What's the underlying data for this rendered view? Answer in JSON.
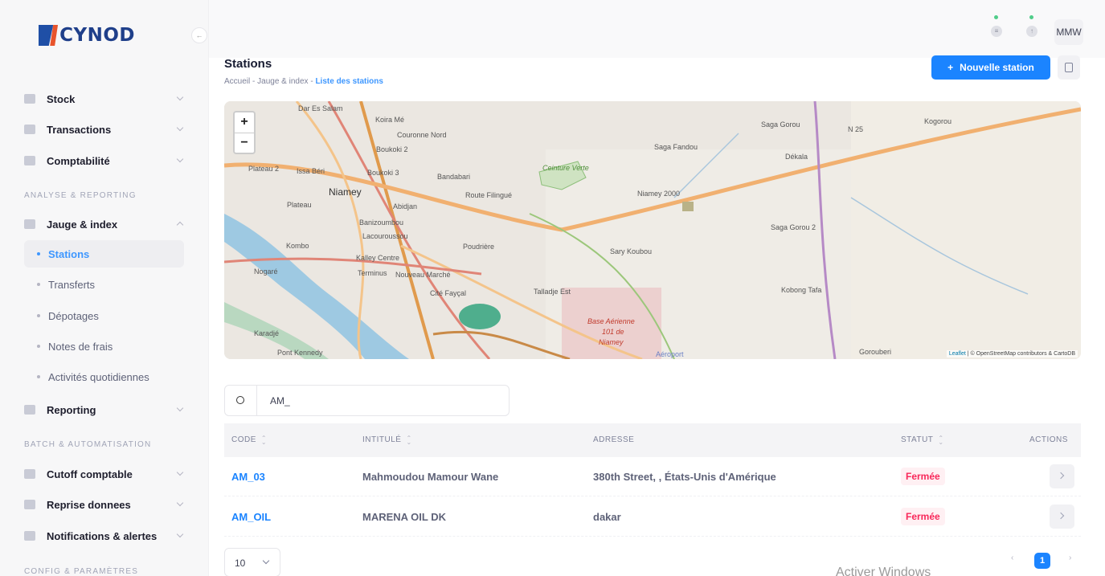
{
  "app": {
    "logo_text": "CYNOD"
  },
  "topbar": {
    "user_initials": "MMW"
  },
  "sidebar": {
    "items": [
      {
        "label": "Stock",
        "icon": "box-icon"
      },
      {
        "label": "Transactions",
        "icon": "transactions-icon"
      },
      {
        "label": "Comptabilité",
        "icon": "grid-icon"
      }
    ],
    "section_analyse": "ANALYSE & REPORTING",
    "jauge": {
      "label": "Jauge & index",
      "icon": "gauge-icon"
    },
    "sub_items": [
      {
        "label": "Stations",
        "active": true
      },
      {
        "label": "Transferts",
        "active": false
      },
      {
        "label": "Dépotages",
        "active": false
      },
      {
        "label": "Notes de frais",
        "active": false
      },
      {
        "label": "Activités quotidiennes",
        "active": false
      }
    ],
    "reporting": {
      "label": "Reporting",
      "icon": "chart-icon"
    },
    "section_batch": "BATCH & AUTOMATISATION",
    "batch_items": [
      {
        "label": "Cutoff comptable",
        "icon": "cutoff-icon"
      },
      {
        "label": "Reprise donnees",
        "icon": "chart-icon"
      },
      {
        "label": "Notifications & alertes",
        "icon": "bell-icon"
      }
    ],
    "section_config": "CONFIG & PARAMÈTRES"
  },
  "page": {
    "title": "Stations",
    "breadcrumb": [
      "Accueil",
      "Jauge & index",
      "Liste des stations"
    ],
    "breadcrumb_sep": "-",
    "new_button": "Nouvelle station"
  },
  "map": {
    "zoom_in": "+",
    "zoom_out": "−",
    "labels": [
      "Dar Es Salam",
      "Koira Mé",
      "Couronne Nord",
      "Boukoki 2",
      "Plateau 2",
      "Issa Béri",
      "Boukoki 3",
      "Bandabari",
      "Niamey",
      "Plateau",
      "Abidjan",
      "Route Filingué",
      "Banizoumbou",
      "Lacouroussou",
      "Poudrière",
      "Kombo",
      "Kalley Centre",
      "Nogaré",
      "Terminus",
      "Nouveau Marché",
      "Cité Fayçal",
      "Talladje Est",
      "Karadjé",
      "Pont Kennedy",
      "Saga Gorou",
      "Saga Fandou",
      "Dékala",
      "Niamey 2000",
      "Saga Gorou 2",
      "Sary Koubou",
      "Kobong Tafa",
      "Gorouberi",
      "Kogorou",
      "N 25",
      "Ceinture Verte",
      "Base Aérienne",
      "101 de",
      "Niamey",
      "Aéroport"
    ],
    "attribution_leaflet": "Leaflet",
    "attribution_rest": "| © OpenStreetMap contributors & CartoDB"
  },
  "search": {
    "value": "AM_"
  },
  "table": {
    "headers": {
      "code": "CODE",
      "intitule": "INTITULÉ",
      "adresse": "ADRESSE",
      "statut": "STATUT",
      "actions": "ACTIONS"
    },
    "rows": [
      {
        "code": "AM_03",
        "intitule": "Mahmoudou Mamour Wane",
        "adresse": "380th Street, , États-Unis d'Amérique",
        "statut": "Fermée"
      },
      {
        "code": "AM_OIL",
        "intitule": "MARENA OIL DK",
        "adresse": "dakar",
        "statut": "Fermée"
      }
    ]
  },
  "footer": {
    "page_size": "10",
    "current_page": "1",
    "prev": "‹",
    "next": "›",
    "watermark": "Activer Windows"
  },
  "colors": {
    "primary": "#1b84ff",
    "danger": "#f8285a",
    "logo_blue": "#1f3f8a",
    "logo_orange": "#e8542c"
  }
}
